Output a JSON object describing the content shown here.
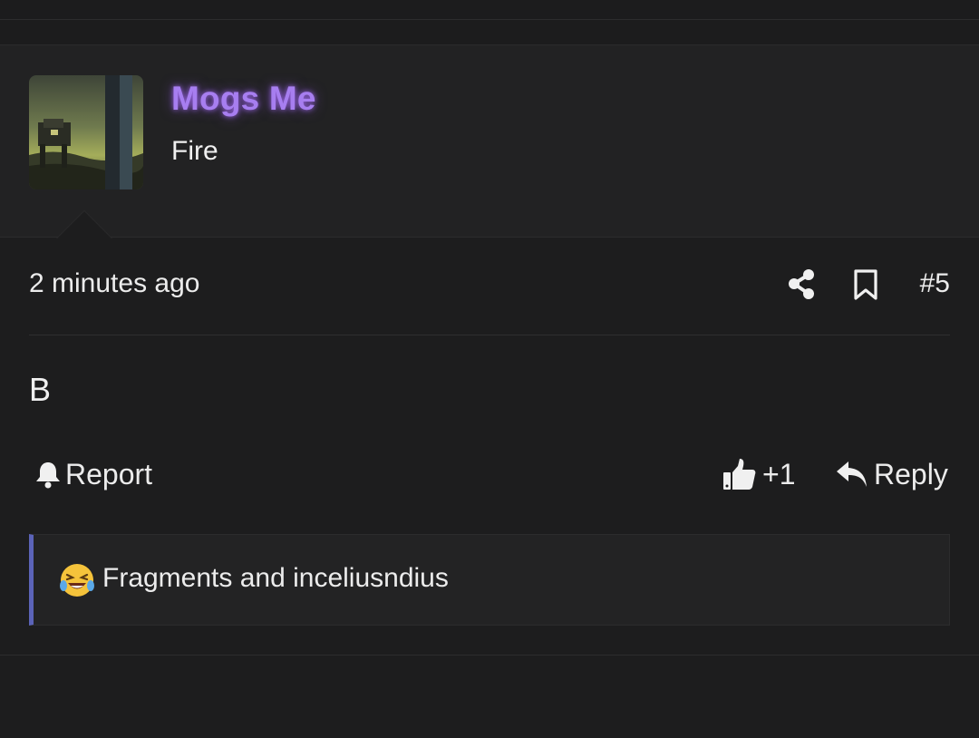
{
  "post": {
    "author": {
      "username": "Mogs Me",
      "user_title": "Fire",
      "avatar_icon": "avatar-mech-in-field"
    },
    "meta": {
      "timestamp": "2 minutes ago",
      "post_number": "#5",
      "share_icon": "share-icon",
      "bookmark_icon": "bookmark-icon"
    },
    "body": "B",
    "actions": {
      "report_label": "Report",
      "like_count": "+1",
      "reply_label": "Reply"
    },
    "reaction": {
      "emoji": "laughing-crying-emoji",
      "text": "Fragments and inceliusndius"
    }
  },
  "colors": {
    "background": "#1d1d1e",
    "header_background": "#222223",
    "username_color": "#a77ef0",
    "reaction_accent": "#5b63b8"
  }
}
